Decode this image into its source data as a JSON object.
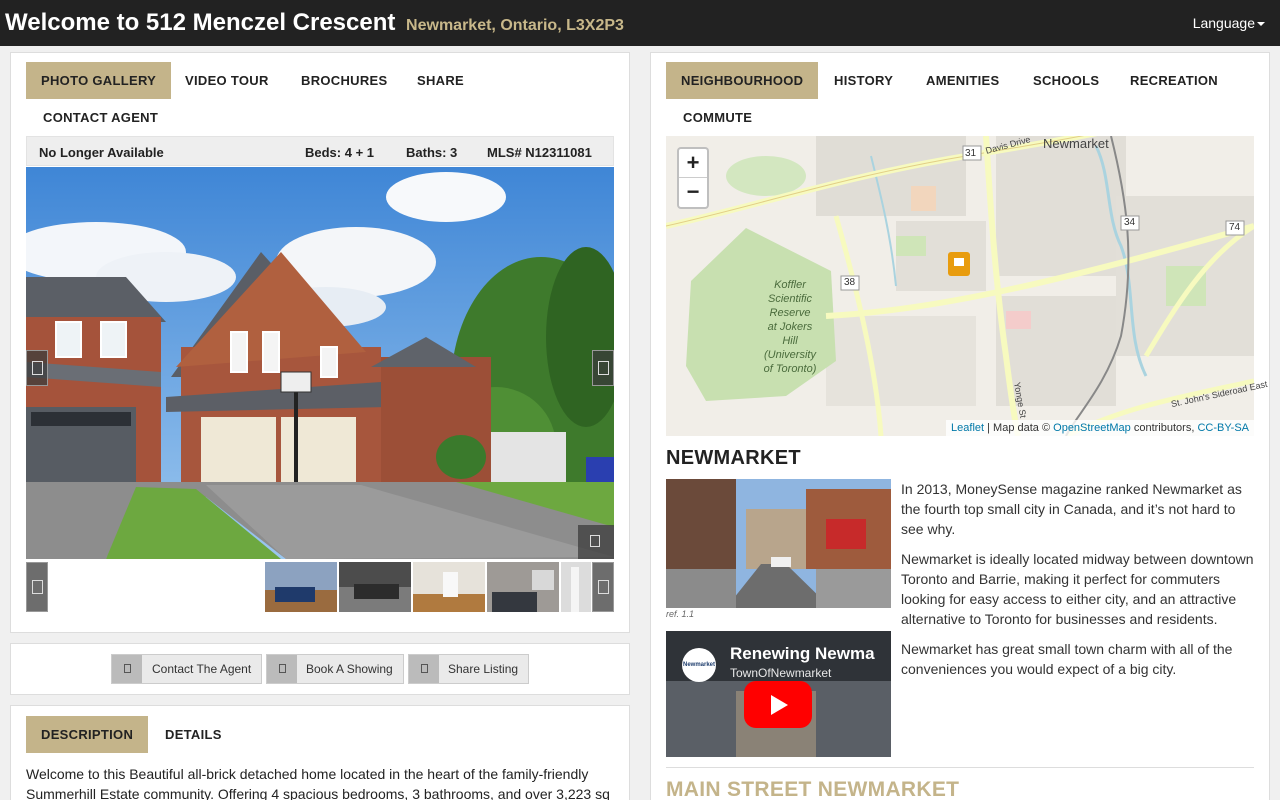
{
  "header": {
    "title": "Welcome to 512 Menczel Crescent",
    "subtitle": "Newmarket, Ontario, L3X2P3",
    "language_label": "Language"
  },
  "left_tabs": [
    {
      "label": "PHOTO GALLERY",
      "active": true
    },
    {
      "label": "VIDEO TOUR",
      "active": false
    },
    {
      "label": "BROCHURES",
      "active": false
    },
    {
      "label": "SHARE",
      "active": false
    },
    {
      "label": "CONTACT AGENT",
      "active": false
    }
  ],
  "listing": {
    "status": "No Longer Available",
    "beds": "Beds: 4 + 1",
    "baths": "Baths: 3",
    "mls": "MLS# N12311081"
  },
  "actions": [
    {
      "label": "Contact The Agent",
      "icon": "user-icon"
    },
    {
      "label": "Book A Showing",
      "icon": "calendar-icon"
    },
    {
      "label": "Share Listing",
      "icon": "share-icon"
    }
  ],
  "desc_tabs": [
    {
      "label": "DESCRIPTION",
      "active": true
    },
    {
      "label": "DETAILS",
      "active": false
    }
  ],
  "description": "Welcome to this Beautiful all-brick detached home located in the heart of the family-friendly Summerhill Estate community. Offering 4 spacious bedrooms, 3 bathrooms, and over 3,223 sq",
  "right_tabs": [
    {
      "label": "NEIGHBOURHOOD",
      "active": true
    },
    {
      "label": "HISTORY",
      "active": false
    },
    {
      "label": "AMENITIES",
      "active": false
    },
    {
      "label": "SCHOOLS",
      "active": false
    },
    {
      "label": "RECREATION",
      "active": false
    },
    {
      "label": "COMMUTE",
      "active": false
    }
  ],
  "map": {
    "zoom_in": "+",
    "zoom_out": "−",
    "labels": {
      "town": "Newmarket",
      "road1": "Davis Drive",
      "road2": "St. John's Sideroad East",
      "road3": "Yonge St",
      "route31": "31",
      "route34": "34",
      "route38": "38",
      "route74": "74",
      "reserve": [
        "Koffler",
        "Scientific",
        "Reserve",
        "at Jokers",
        "Hill (University",
        "of Toronto)"
      ]
    },
    "attribution": {
      "leaflet": "Leaflet",
      "sep": " | Map data © ",
      "osm": "OpenStreetMap",
      "contrib": " contributors, ",
      "license": "CC-BY-SA"
    }
  },
  "neighbourhood": {
    "heading": "NEWMARKET",
    "image_caption": "ref. 1.1",
    "paragraphs": [
      "In 2013, MoneySense magazine ranked Newmarket as the fourth top small city in Canada, and it’s not hard to see why.",
      "Newmarket is ideally located midway between downtown Toronto and Barrie, making it perfect for commuters looking for easy access to either city, and an attractive alternative to Toronto for businesses and residents.",
      "Newmarket has great small town charm with all of the conveniences you would expect of a big city."
    ],
    "video": {
      "title": "Renewing Newma",
      "channel": "TownOfNewmarket",
      "logo_text": "Newmarket"
    },
    "section2": "MAIN STREET NEWMARKET"
  },
  "colors": {
    "accent": "#c4b48a",
    "header_bg": "#222222",
    "section_title": "#c4b48a",
    "youtube_red": "#ff0000"
  }
}
